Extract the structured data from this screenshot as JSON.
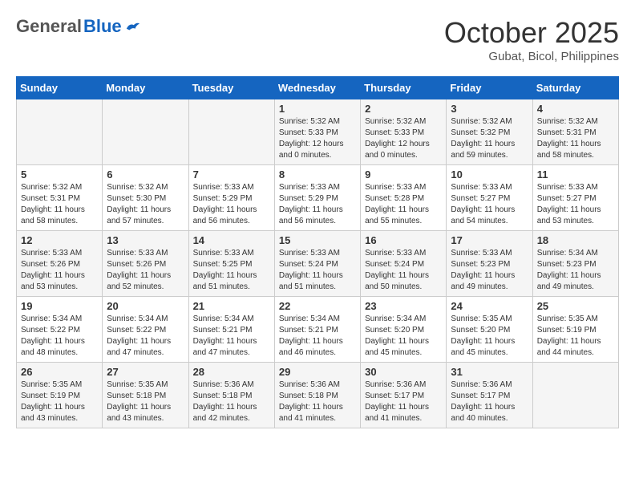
{
  "header": {
    "logo_general": "General",
    "logo_blue": "Blue",
    "month": "October 2025",
    "location": "Gubat, Bicol, Philippines"
  },
  "weekdays": [
    "Sunday",
    "Monday",
    "Tuesday",
    "Wednesday",
    "Thursday",
    "Friday",
    "Saturday"
  ],
  "weeks": [
    [
      {
        "day": "",
        "info": ""
      },
      {
        "day": "",
        "info": ""
      },
      {
        "day": "",
        "info": ""
      },
      {
        "day": "1",
        "info": "Sunrise: 5:32 AM\nSunset: 5:33 PM\nDaylight: 12 hours\nand 0 minutes."
      },
      {
        "day": "2",
        "info": "Sunrise: 5:32 AM\nSunset: 5:33 PM\nDaylight: 12 hours\nand 0 minutes."
      },
      {
        "day": "3",
        "info": "Sunrise: 5:32 AM\nSunset: 5:32 PM\nDaylight: 11 hours\nand 59 minutes."
      },
      {
        "day": "4",
        "info": "Sunrise: 5:32 AM\nSunset: 5:31 PM\nDaylight: 11 hours\nand 58 minutes."
      }
    ],
    [
      {
        "day": "5",
        "info": "Sunrise: 5:32 AM\nSunset: 5:31 PM\nDaylight: 11 hours\nand 58 minutes."
      },
      {
        "day": "6",
        "info": "Sunrise: 5:32 AM\nSunset: 5:30 PM\nDaylight: 11 hours\nand 57 minutes."
      },
      {
        "day": "7",
        "info": "Sunrise: 5:33 AM\nSunset: 5:29 PM\nDaylight: 11 hours\nand 56 minutes."
      },
      {
        "day": "8",
        "info": "Sunrise: 5:33 AM\nSunset: 5:29 PM\nDaylight: 11 hours\nand 56 minutes."
      },
      {
        "day": "9",
        "info": "Sunrise: 5:33 AM\nSunset: 5:28 PM\nDaylight: 11 hours\nand 55 minutes."
      },
      {
        "day": "10",
        "info": "Sunrise: 5:33 AM\nSunset: 5:27 PM\nDaylight: 11 hours\nand 54 minutes."
      },
      {
        "day": "11",
        "info": "Sunrise: 5:33 AM\nSunset: 5:27 PM\nDaylight: 11 hours\nand 53 minutes."
      }
    ],
    [
      {
        "day": "12",
        "info": "Sunrise: 5:33 AM\nSunset: 5:26 PM\nDaylight: 11 hours\nand 53 minutes."
      },
      {
        "day": "13",
        "info": "Sunrise: 5:33 AM\nSunset: 5:26 PM\nDaylight: 11 hours\nand 52 minutes."
      },
      {
        "day": "14",
        "info": "Sunrise: 5:33 AM\nSunset: 5:25 PM\nDaylight: 11 hours\nand 51 minutes."
      },
      {
        "day": "15",
        "info": "Sunrise: 5:33 AM\nSunset: 5:24 PM\nDaylight: 11 hours\nand 51 minutes."
      },
      {
        "day": "16",
        "info": "Sunrise: 5:33 AM\nSunset: 5:24 PM\nDaylight: 11 hours\nand 50 minutes."
      },
      {
        "day": "17",
        "info": "Sunrise: 5:33 AM\nSunset: 5:23 PM\nDaylight: 11 hours\nand 49 minutes."
      },
      {
        "day": "18",
        "info": "Sunrise: 5:34 AM\nSunset: 5:23 PM\nDaylight: 11 hours\nand 49 minutes."
      }
    ],
    [
      {
        "day": "19",
        "info": "Sunrise: 5:34 AM\nSunset: 5:22 PM\nDaylight: 11 hours\nand 48 minutes."
      },
      {
        "day": "20",
        "info": "Sunrise: 5:34 AM\nSunset: 5:22 PM\nDaylight: 11 hours\nand 47 minutes."
      },
      {
        "day": "21",
        "info": "Sunrise: 5:34 AM\nSunset: 5:21 PM\nDaylight: 11 hours\nand 47 minutes."
      },
      {
        "day": "22",
        "info": "Sunrise: 5:34 AM\nSunset: 5:21 PM\nDaylight: 11 hours\nand 46 minutes."
      },
      {
        "day": "23",
        "info": "Sunrise: 5:34 AM\nSunset: 5:20 PM\nDaylight: 11 hours\nand 45 minutes."
      },
      {
        "day": "24",
        "info": "Sunrise: 5:35 AM\nSunset: 5:20 PM\nDaylight: 11 hours\nand 45 minutes."
      },
      {
        "day": "25",
        "info": "Sunrise: 5:35 AM\nSunset: 5:19 PM\nDaylight: 11 hours\nand 44 minutes."
      }
    ],
    [
      {
        "day": "26",
        "info": "Sunrise: 5:35 AM\nSunset: 5:19 PM\nDaylight: 11 hours\nand 43 minutes."
      },
      {
        "day": "27",
        "info": "Sunrise: 5:35 AM\nSunset: 5:18 PM\nDaylight: 11 hours\nand 43 minutes."
      },
      {
        "day": "28",
        "info": "Sunrise: 5:36 AM\nSunset: 5:18 PM\nDaylight: 11 hours\nand 42 minutes."
      },
      {
        "day": "29",
        "info": "Sunrise: 5:36 AM\nSunset: 5:18 PM\nDaylight: 11 hours\nand 41 minutes."
      },
      {
        "day": "30",
        "info": "Sunrise: 5:36 AM\nSunset: 5:17 PM\nDaylight: 11 hours\nand 41 minutes."
      },
      {
        "day": "31",
        "info": "Sunrise: 5:36 AM\nSunset: 5:17 PM\nDaylight: 11 hours\nand 40 minutes."
      },
      {
        "day": "",
        "info": ""
      }
    ]
  ]
}
